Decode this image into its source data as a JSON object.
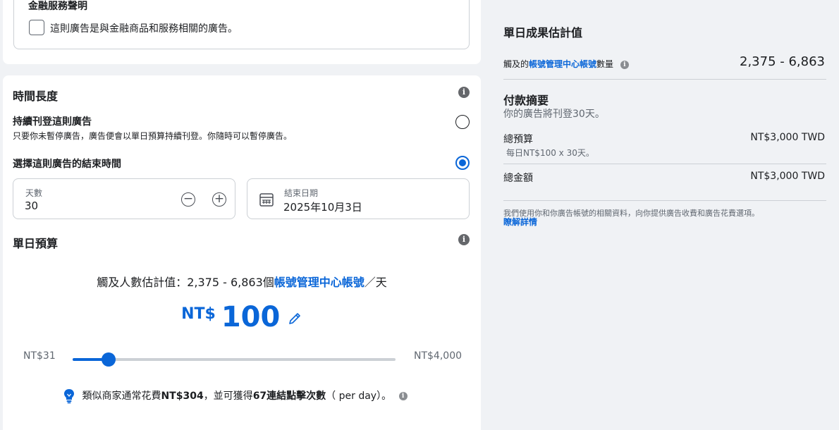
{
  "financial": {
    "title": "金融服務聲明",
    "checkbox_label": "這則廣告是與金融商品和服務相關的廣告。"
  },
  "duration": {
    "title": "時間長度",
    "option_continuous_title": "持續刊登這則廣告",
    "option_continuous_desc": "只要你未暫停廣告，廣告便會以單日預算持續刊登。你隨時可以暫停廣告。",
    "option_end_title": "選擇這則廣告的結束時間",
    "days_label": "天數",
    "days_value": "30",
    "end_date_label": "結束日期",
    "end_date_value": "2025年10月3日"
  },
  "daily_budget": {
    "title": "單日預算",
    "reach_prefix": "觸及人數估計值：2,375 - 6,863個",
    "reach_link": "帳號管理中心帳號",
    "reach_suffix": "／天",
    "currency": "NT$",
    "amount": "100",
    "slider_min": "NT$31",
    "slider_max": "NT$4,000",
    "slider_fraction": 0.0174,
    "tip_part1": "類似商家通常花費",
    "tip_amount": "NT$304",
    "tip_part2": "，並可獲得",
    "tip_clicks": "67連結點擊次數",
    "tip_part3": "（ per day）。"
  },
  "estimates": {
    "title": "單日成果估計值",
    "reach_prefix": "觸及的",
    "reach_link": "帳號管理中心帳號",
    "reach_suffix": "數量",
    "reach_value": "2,375 - 6,863"
  },
  "payment": {
    "title": "付款摘要",
    "subtitle": "你的廣告將刊登30天。",
    "total_budget_label": "總預算",
    "total_budget_value": "NT$3,000 TWD",
    "total_budget_detail": "每日NT$100 x 30天。",
    "total_amount_label": "總金額",
    "total_amount_value": "NT$3,000 TWD",
    "note": "我們使用你和你廣告帳號的相關資料，向你提供廣告收費和廣告花費選項。",
    "learn_more": "瞭解詳情"
  },
  "colors": {
    "accent": "#0a66d8",
    "background": "#f0f2f5"
  }
}
